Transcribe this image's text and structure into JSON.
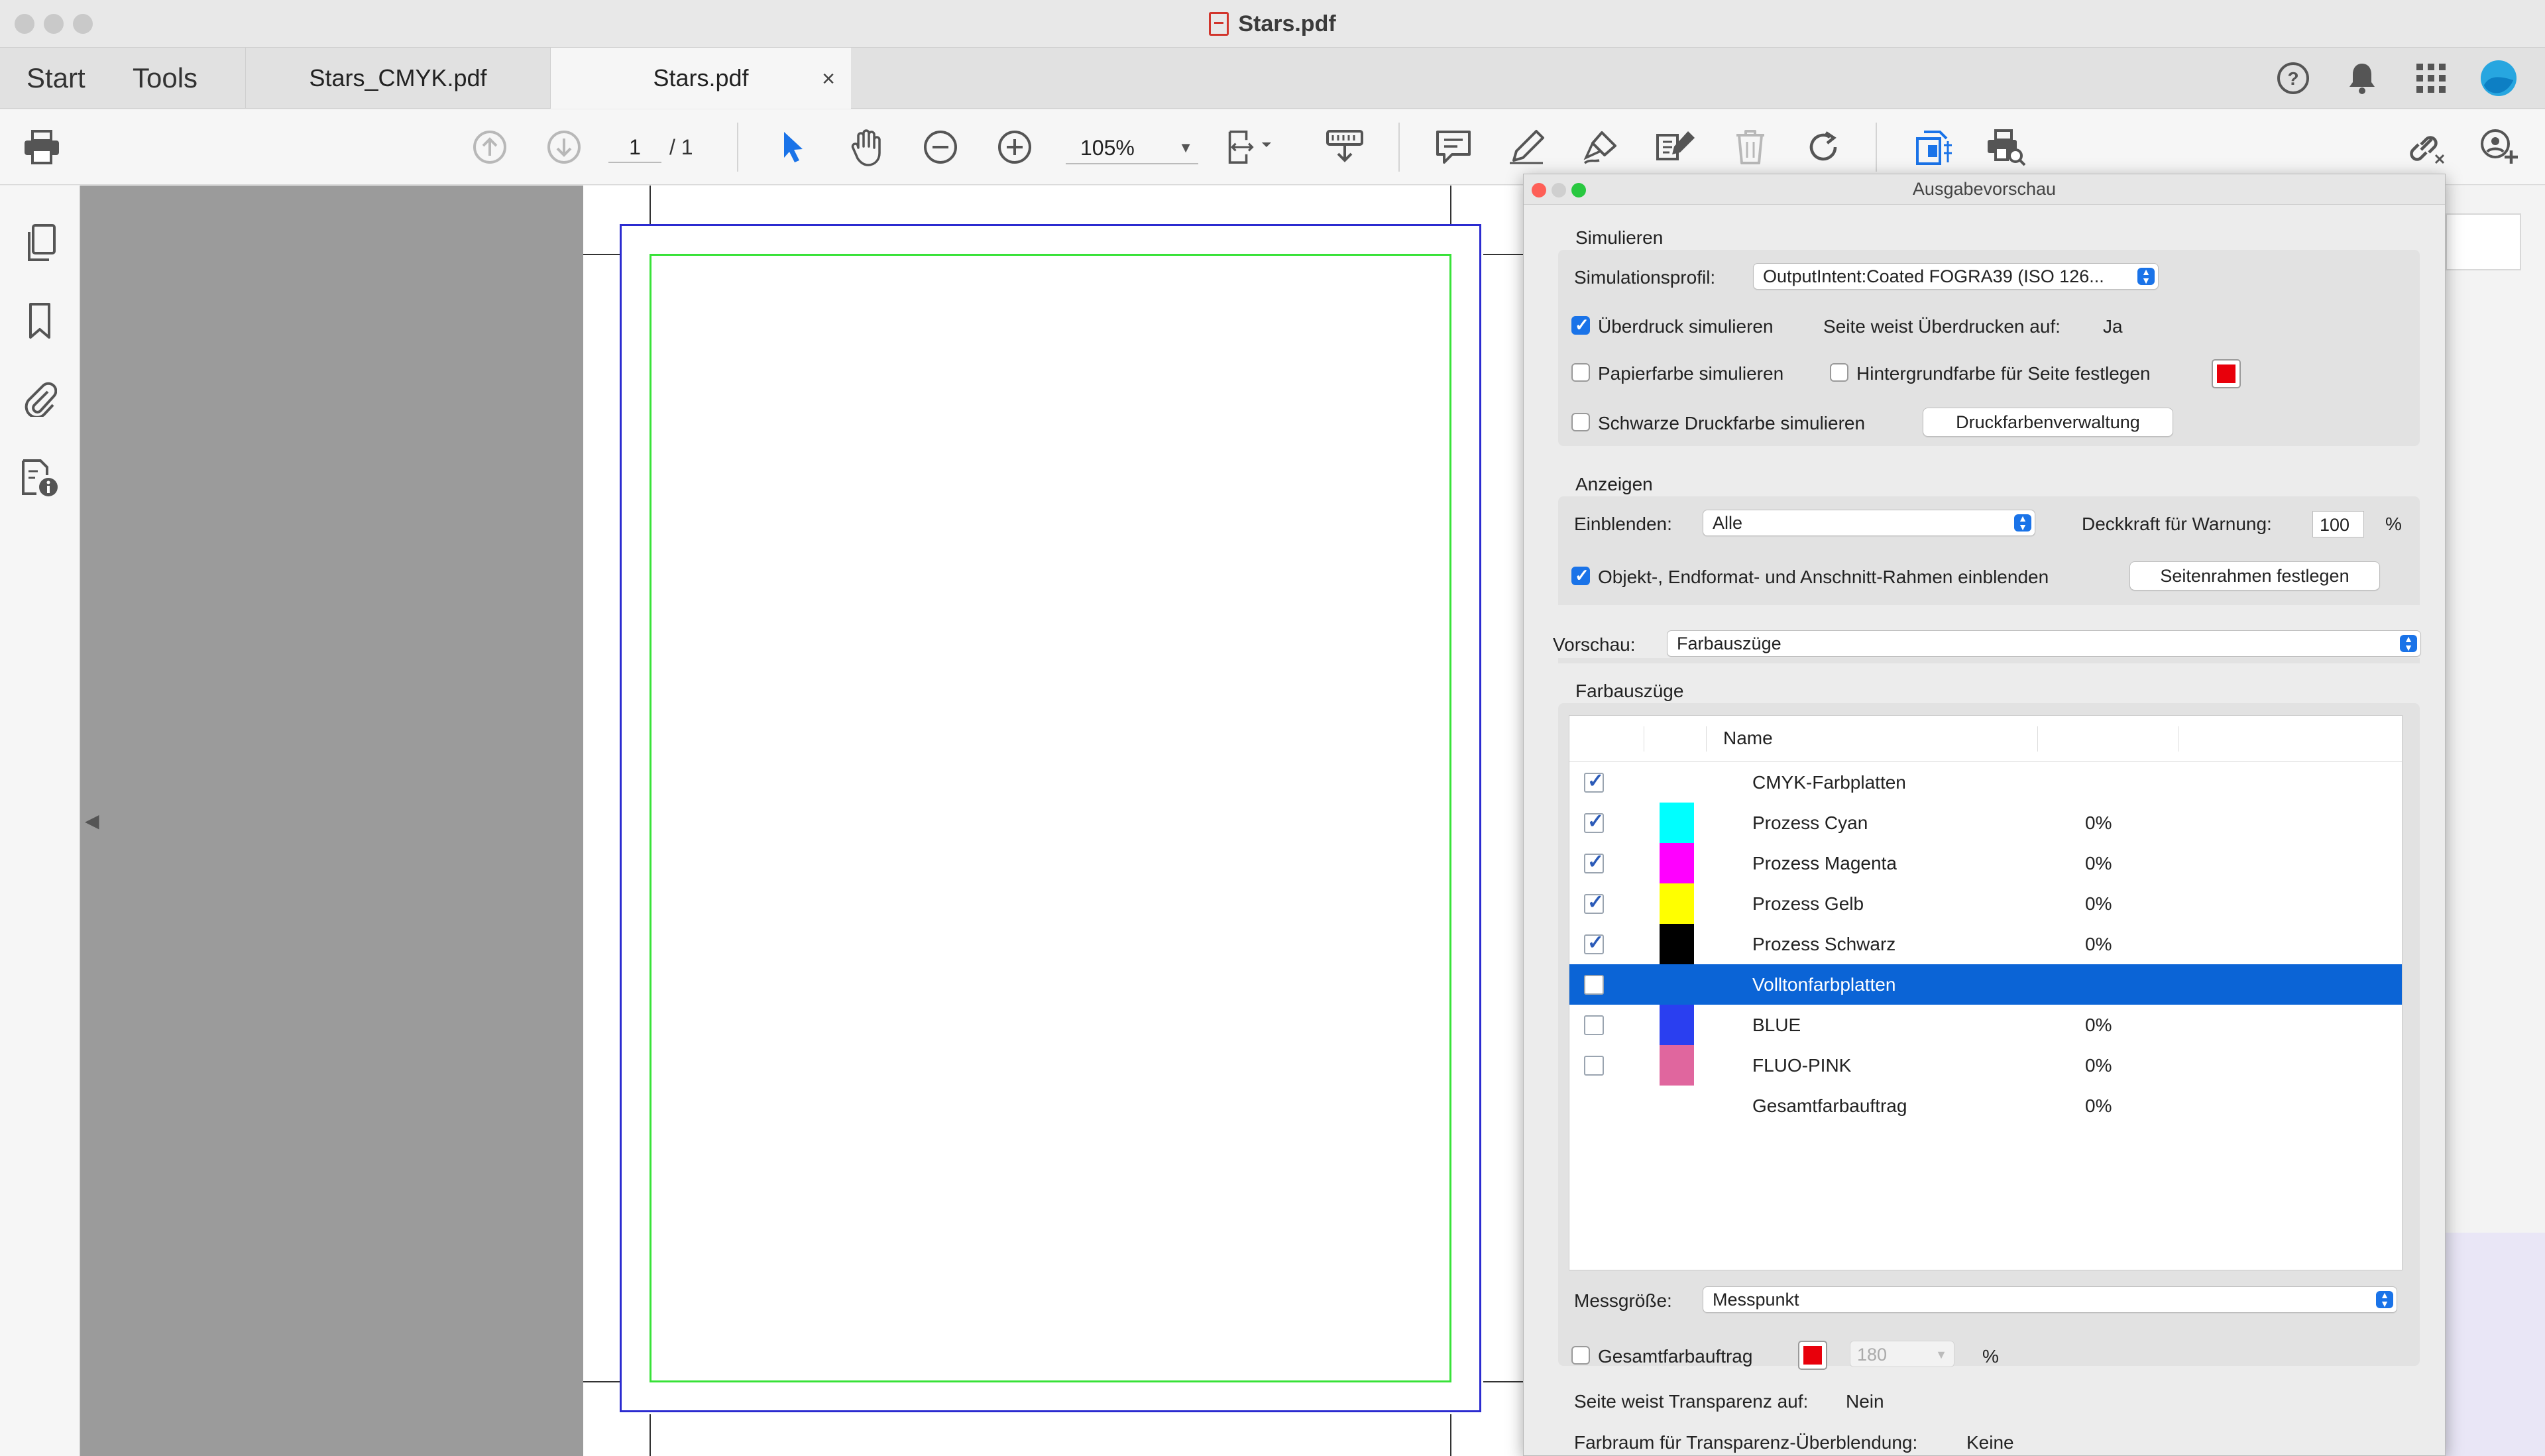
{
  "window": {
    "title": "Stars.pdf"
  },
  "tabs": {
    "start": "Start",
    "tools": "Tools",
    "documents": [
      {
        "label": "Stars_CMYK.pdf",
        "active": false
      },
      {
        "label": "Stars.pdf",
        "active": true
      }
    ],
    "close_glyph": "×"
  },
  "header_icons": [
    "help-icon",
    "bell-icon",
    "apps-grid-icon",
    "account-avatar"
  ],
  "toolbar": {
    "page_current": "1",
    "page_total": "/ 1",
    "zoom": "105%"
  },
  "panel": {
    "title": "Ausgabevorschau",
    "simulate": {
      "heading": "Simulieren",
      "profile_label": "Simulationsprofil:",
      "profile_value": "OutputIntent:Coated FOGRA39 (ISO 126...",
      "overprint_label": "Überdruck simulieren",
      "overprint_checked": true,
      "page_overprint_label": "Seite weist Überdrucken auf:",
      "page_overprint_value": "Ja",
      "paper_color_label": "Papierfarbe simulieren",
      "bg_color_label": "Hintergrundfarbe für Seite festlegen",
      "black_ink_label": "Schwarze Druckfarbe simulieren",
      "ink_manager_button": "Druckfarbenverwaltung"
    },
    "show": {
      "heading": "Anzeigen",
      "show_label": "Einblenden:",
      "show_value": "Alle",
      "opacity_label": "Deckkraft für Warnung:",
      "opacity_value": "100",
      "percent": "%",
      "frames_label": "Objekt-, Endformat- und Anschnitt-Rahmen einblenden",
      "frames_checked": true,
      "page_frames_button": "Seitenrahmen festlegen"
    },
    "preview": {
      "label": "Vorschau:",
      "value": "Farbauszüge"
    },
    "separations": {
      "heading": "Farbauszüge",
      "column_name": "Name",
      "rows": [
        {
          "name": "CMYK-Farbplatten",
          "value": "",
          "checked": true,
          "swatch": "",
          "selected": false
        },
        {
          "name": "Prozess Cyan",
          "value": "0%",
          "checked": true,
          "swatch": "#00ffff",
          "selected": false
        },
        {
          "name": "Prozess Magenta",
          "value": "0%",
          "checked": true,
          "swatch": "#ff00ff",
          "selected": false
        },
        {
          "name": "Prozess Gelb",
          "value": "0%",
          "checked": true,
          "swatch": "#ffff00",
          "selected": false
        },
        {
          "name": "Prozess Schwarz",
          "value": "0%",
          "checked": true,
          "swatch": "#000000",
          "selected": false
        },
        {
          "name": "Volltonfarbplatten",
          "value": "",
          "checked": false,
          "swatch": "",
          "selected": true
        },
        {
          "name": "BLUE",
          "value": "0%",
          "checked": false,
          "swatch": "#2a3ff0",
          "selected": false
        },
        {
          "name": "FLUO-PINK",
          "value": "0%",
          "checked": false,
          "swatch": "#e0669e",
          "selected": false
        },
        {
          "name": "Gesamtfarbauftrag",
          "value": "0%",
          "checked": null,
          "swatch": "",
          "selected": false
        }
      ]
    },
    "sample_size": {
      "label": "Messgröße:",
      "value": "Messpunkt"
    },
    "total_coverage": {
      "label": "Gesamtfarbauftrag",
      "value": "180",
      "percent": "%"
    },
    "transparency": {
      "label": "Seite weist Transparenz auf:",
      "value": "Nein"
    },
    "blend_space": {
      "label": "Farbraum für Transparenz-Überblendung:",
      "value": "Keine"
    }
  },
  "colors": {
    "accent": "#1a73e8",
    "selection": "#0b64d6",
    "bleed_box": "#2b2bd0",
    "trim_box": "#38e238"
  }
}
